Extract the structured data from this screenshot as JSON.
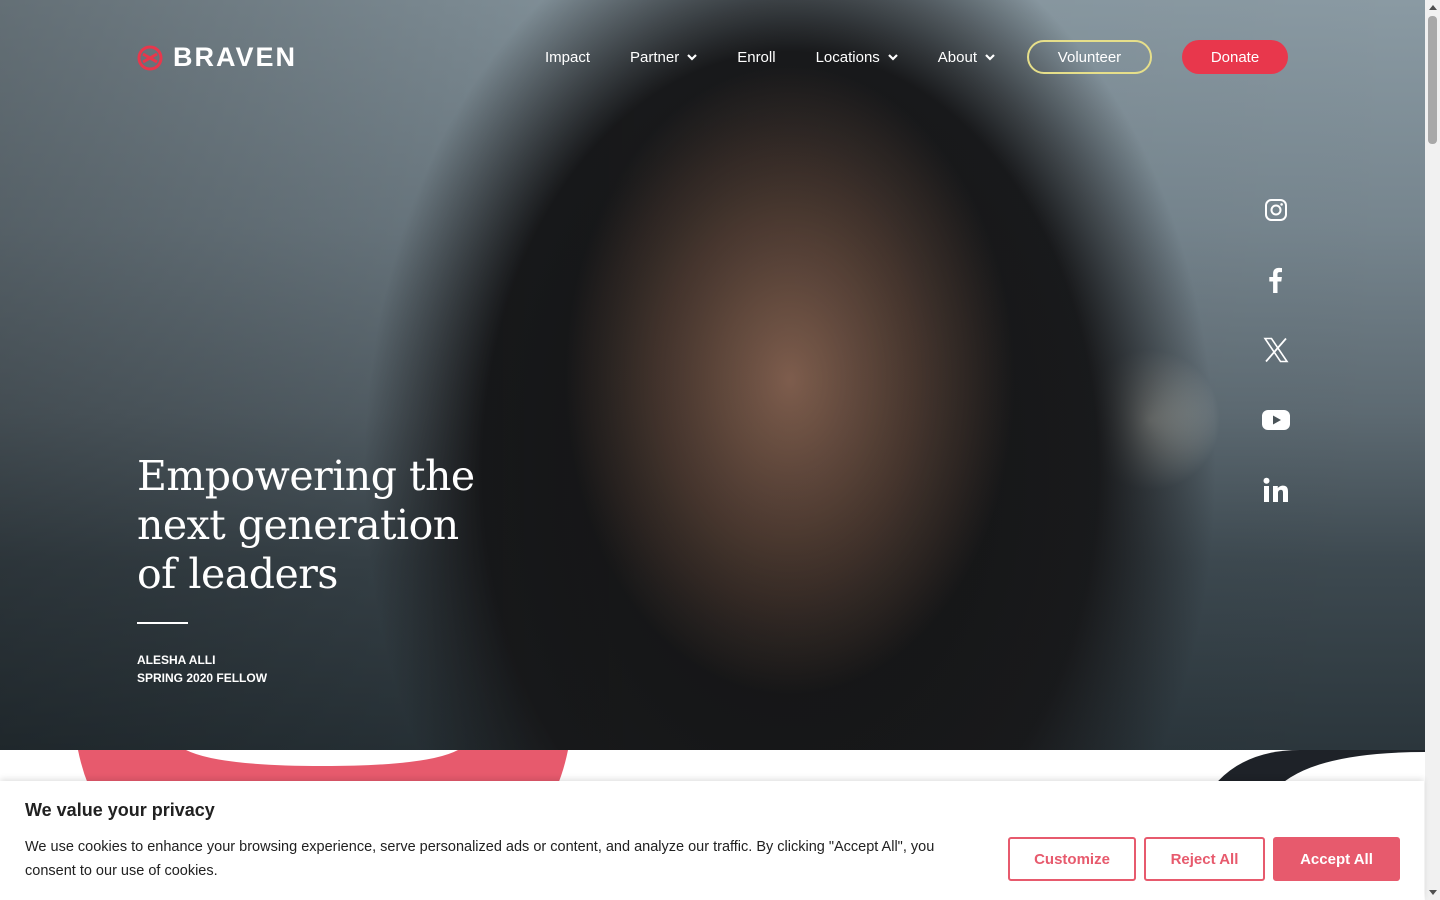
{
  "brand": {
    "name": "BRAVEN",
    "accent": "#e8374c"
  },
  "nav": {
    "items": [
      {
        "label": "Impact",
        "dropdown": false
      },
      {
        "label": "Partner",
        "dropdown": true
      },
      {
        "label": "Enroll",
        "dropdown": false
      },
      {
        "label": "Locations",
        "dropdown": true
      },
      {
        "label": "About",
        "dropdown": true
      }
    ],
    "volunteer_label": "Volunteer",
    "donate_label": "Donate"
  },
  "social": [
    "instagram-icon",
    "facebook-icon",
    "x-icon",
    "youtube-icon",
    "linkedin-icon"
  ],
  "hero": {
    "headline": "Empowering the next generation of leaders",
    "credit_name": "ALESHA ALLI",
    "credit_role": "SPRING 2020 FELLOW"
  },
  "cookie": {
    "title": "We value your privacy",
    "text": "We use cookies to enhance your browsing experience, serve personalized ads or content, and analyze our traffic. By clicking \"Accept All\", you consent to our use of cookies.",
    "customize_label": "Customize",
    "reject_label": "Reject All",
    "accept_label": "Accept All",
    "accent": "#e75a6d"
  }
}
